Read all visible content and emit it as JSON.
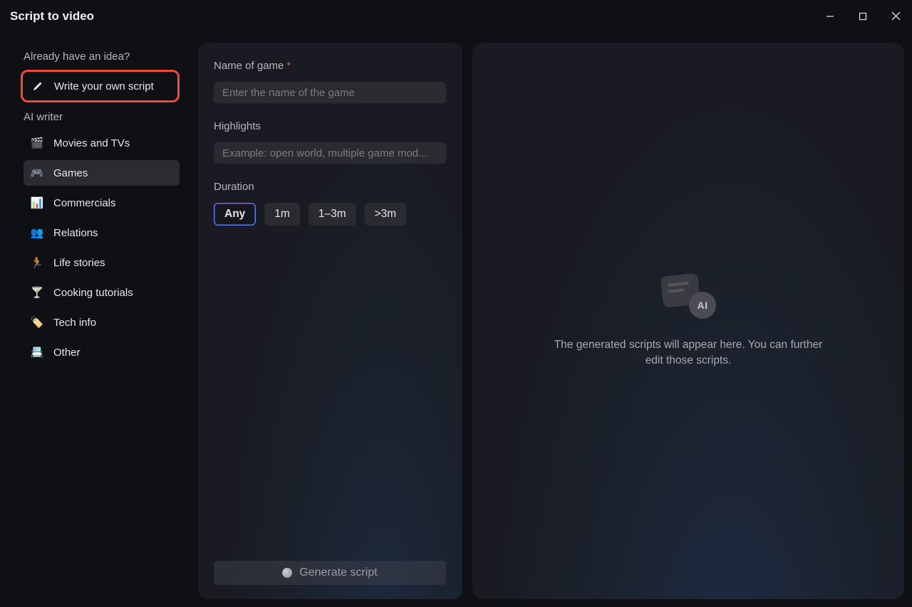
{
  "titlebar": {
    "title": "Script to video"
  },
  "sidebar": {
    "idea_heading": "Already have an idea?",
    "write_own": "Write your own script",
    "ai_writer_heading": "AI writer",
    "items": [
      {
        "label": "Movies and TVs",
        "icon": "🎬"
      },
      {
        "label": "Games",
        "icon": "🎮"
      },
      {
        "label": "Commercials",
        "icon": "📊"
      },
      {
        "label": "Relations",
        "icon": "👥"
      },
      {
        "label": "Life stories",
        "icon": "🏃"
      },
      {
        "label": "Cooking tutorials",
        "icon": "🍸"
      },
      {
        "label": "Tech info",
        "icon": "🏷️"
      },
      {
        "label": "Other",
        "icon": "📇"
      }
    ]
  },
  "form": {
    "name_label": "Name of game",
    "name_placeholder": "Enter the name of the game",
    "highlights_label": "Highlights",
    "highlights_placeholder": "Example: open world, multiple game mod...",
    "duration_label": "Duration",
    "durations": [
      "Any",
      "1m",
      "1–3m",
      ">3m"
    ],
    "generate_label": "Generate script"
  },
  "right": {
    "ai_badge": "AI",
    "placeholder_line1": "The generated scripts will appear here. You can further",
    "placeholder_line2": "edit those scripts."
  }
}
